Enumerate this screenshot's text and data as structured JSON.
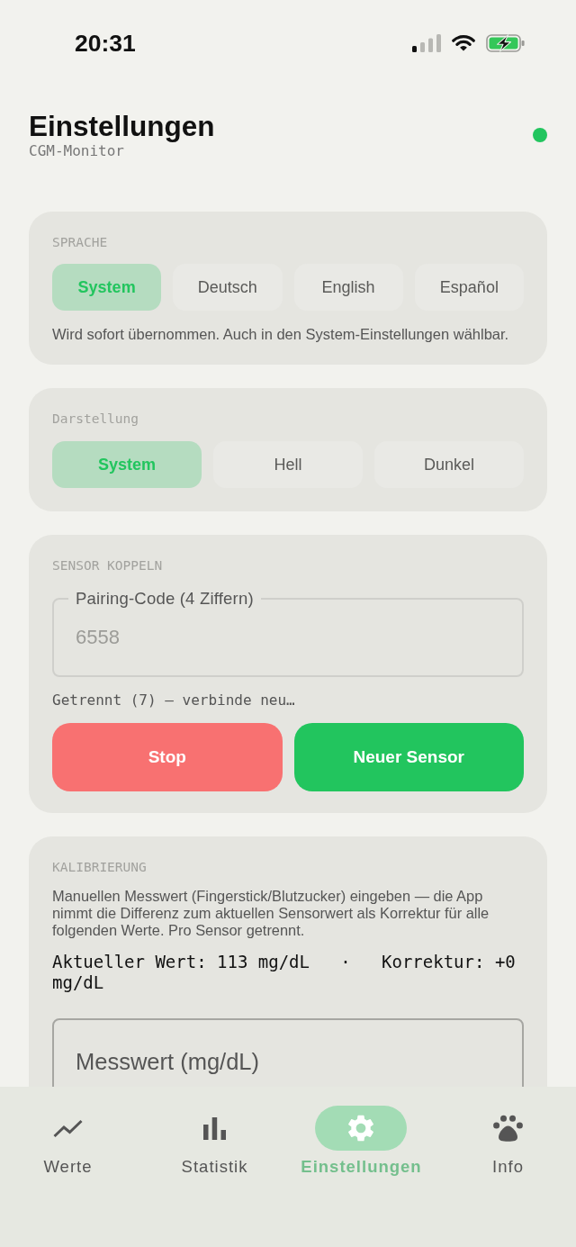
{
  "status_bar": {
    "time": "20:31"
  },
  "header": {
    "title": "Einstellungen",
    "subtitle": "CGM-Monitor",
    "online": true
  },
  "language": {
    "label": "SPRACHE",
    "options": [
      {
        "label": "System",
        "selected": true
      },
      {
        "label": "Deutsch",
        "selected": false
      },
      {
        "label": "English",
        "selected": false
      },
      {
        "label": "Español",
        "selected": false
      }
    ],
    "hint": "Wird sofort übernommen. Auch in den System-Einstellungen wählbar."
  },
  "appearance": {
    "label": "Darstellung",
    "options": [
      {
        "label": "System",
        "selected": true
      },
      {
        "label": "Hell",
        "selected": false
      },
      {
        "label": "Dunkel",
        "selected": false
      }
    ]
  },
  "pairing": {
    "label": "SENSOR KOPPELN",
    "field": {
      "label": "Pairing-Code (4 Ziffern)",
      "placeholder": "6558"
    },
    "status": "Getrennt (7) — verbinde neu…",
    "buttons": [
      {
        "label": "Stop",
        "kind": "danger"
      },
      {
        "label": "Neuer Sensor",
        "kind": "primary"
      }
    ]
  },
  "calibration": {
    "label": "KALIBRIERUNG",
    "description": "Manuellen Messwert (Fingerstick/Blutzucker) eingeben — die App nimmt die Differenz zum aktuellen Sensorwert als Korrektur für alle folgenden Werte. Pro Sensor getrennt.",
    "reading": "Aktueller Wert: 113 mg/dL   ·   Korrektur: +0 mg/dL",
    "field": {
      "placeholder": "Messwert (mg/dL)"
    }
  },
  "tabs": [
    {
      "label": "Werte",
      "selected": false
    },
    {
      "label": "Statistik",
      "selected": false
    },
    {
      "label": "Einstellungen",
      "selected": true
    },
    {
      "label": "Info",
      "selected": false
    }
  ]
}
